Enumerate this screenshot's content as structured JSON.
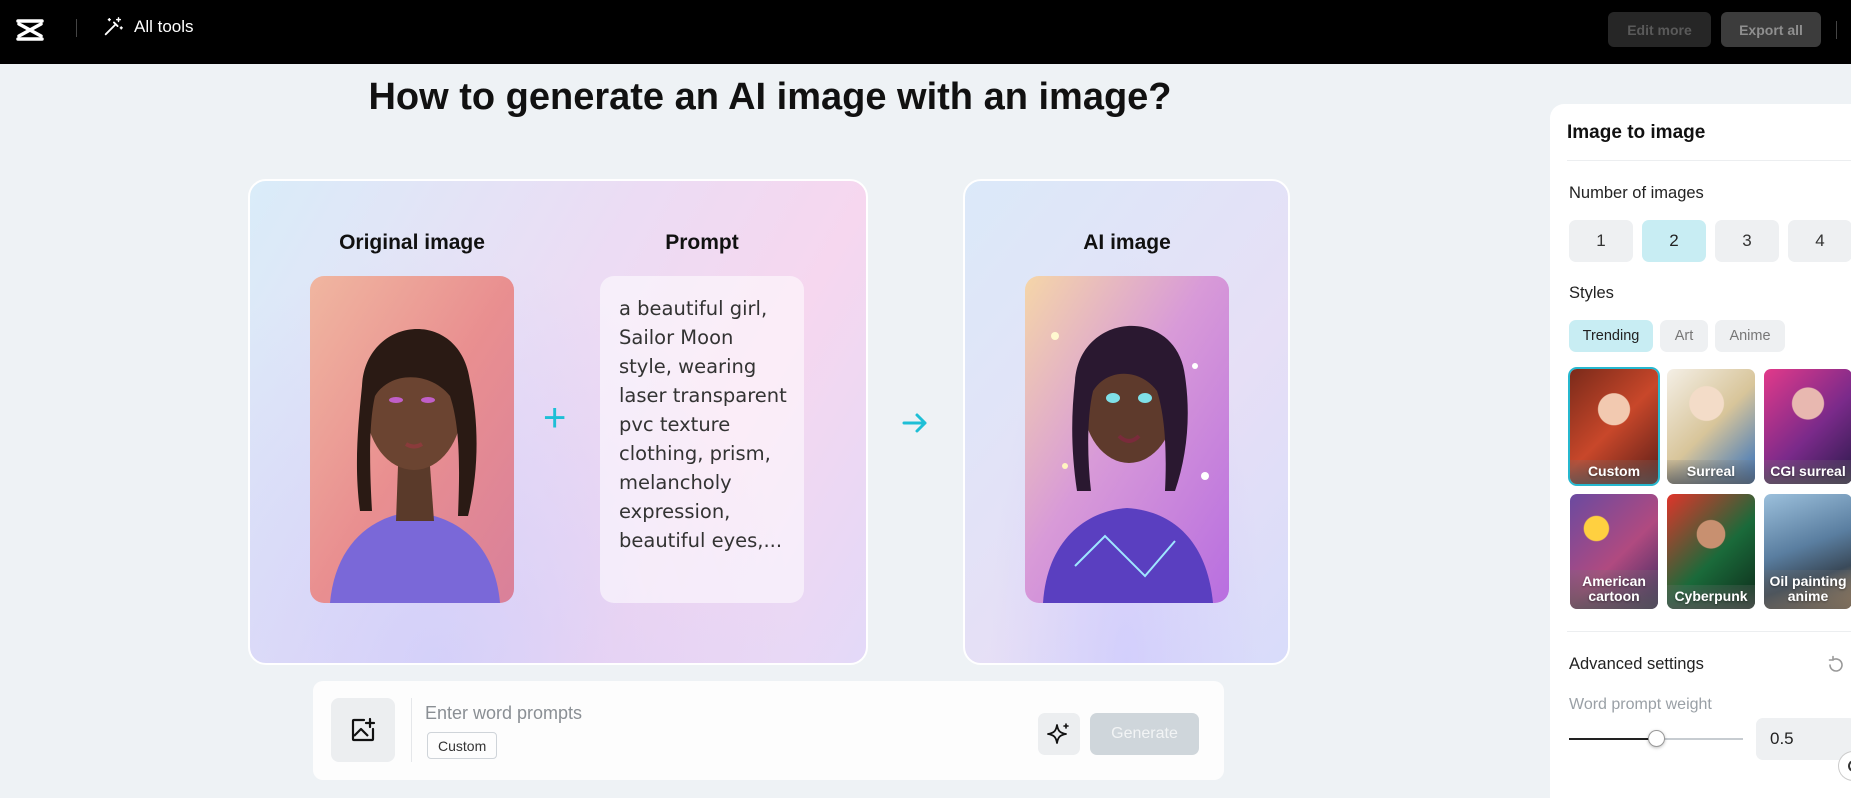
{
  "topbar": {
    "logo_icon": "capcut-logo-icon",
    "tools_label": "All tools",
    "edit_more_label": "Edit more",
    "export_all_label": "Export all"
  },
  "main": {
    "title": "How to generate an AI image with an image?",
    "original_label": "Original image",
    "prompt_label": "Prompt",
    "ai_label": "AI image",
    "prompt_text": "a beautiful girl, Sailor Moon style, wearing laser transparent pvc texture clothing, prism, melancholy expression, beautiful eyes,..."
  },
  "prompt_bar": {
    "placeholder": "Enter word prompts",
    "tag": "Custom",
    "generate_label": "Generate"
  },
  "panel": {
    "title": "Image to image",
    "number_label": "Number of images",
    "numbers": [
      "1",
      "2",
      "3",
      "4"
    ],
    "selected_number": "2",
    "styles_label": "Styles",
    "style_tabs": [
      "Trending",
      "Art",
      "Anime"
    ],
    "active_tab": "Trending",
    "styles": [
      "Custom",
      "Surreal",
      "CGI surreal",
      "American cartoon",
      "Cyberpunk",
      "Oil painting anime"
    ],
    "selected_style": "Custom",
    "advanced_label": "Advanced settings",
    "weight_label": "Word prompt weight",
    "weight_value": "0.5",
    "weight_fraction": 0.5
  },
  "colors": {
    "accent": "#1ebfd6",
    "active_bg": "#c8edf3"
  }
}
